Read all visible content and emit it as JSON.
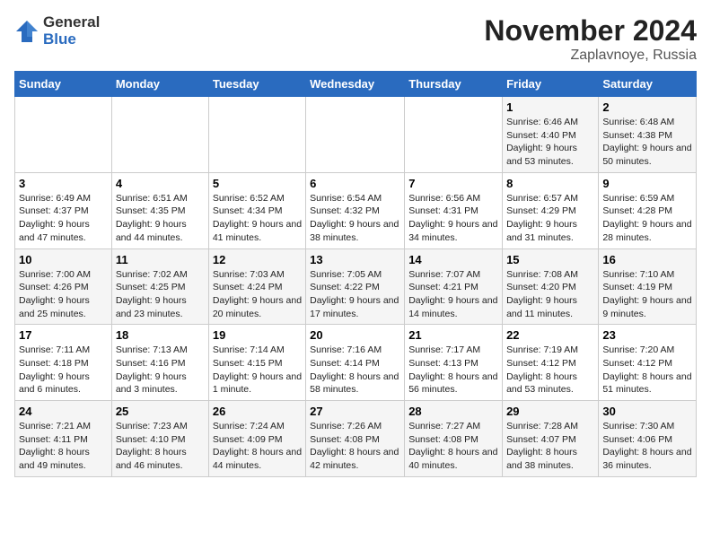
{
  "header": {
    "logo_general": "General",
    "logo_blue": "Blue",
    "month_title": "November 2024",
    "location": "Zaplavnoye, Russia"
  },
  "calendar": {
    "days_of_week": [
      "Sunday",
      "Monday",
      "Tuesday",
      "Wednesday",
      "Thursday",
      "Friday",
      "Saturday"
    ],
    "weeks": [
      [
        {
          "day": "",
          "info": ""
        },
        {
          "day": "",
          "info": ""
        },
        {
          "day": "",
          "info": ""
        },
        {
          "day": "",
          "info": ""
        },
        {
          "day": "",
          "info": ""
        },
        {
          "day": "1",
          "info": "Sunrise: 6:46 AM\nSunset: 4:40 PM\nDaylight: 9 hours and 53 minutes."
        },
        {
          "day": "2",
          "info": "Sunrise: 6:48 AM\nSunset: 4:38 PM\nDaylight: 9 hours and 50 minutes."
        }
      ],
      [
        {
          "day": "3",
          "info": "Sunrise: 6:49 AM\nSunset: 4:37 PM\nDaylight: 9 hours and 47 minutes."
        },
        {
          "day": "4",
          "info": "Sunrise: 6:51 AM\nSunset: 4:35 PM\nDaylight: 9 hours and 44 minutes."
        },
        {
          "day": "5",
          "info": "Sunrise: 6:52 AM\nSunset: 4:34 PM\nDaylight: 9 hours and 41 minutes."
        },
        {
          "day": "6",
          "info": "Sunrise: 6:54 AM\nSunset: 4:32 PM\nDaylight: 9 hours and 38 minutes."
        },
        {
          "day": "7",
          "info": "Sunrise: 6:56 AM\nSunset: 4:31 PM\nDaylight: 9 hours and 34 minutes."
        },
        {
          "day": "8",
          "info": "Sunrise: 6:57 AM\nSunset: 4:29 PM\nDaylight: 9 hours and 31 minutes."
        },
        {
          "day": "9",
          "info": "Sunrise: 6:59 AM\nSunset: 4:28 PM\nDaylight: 9 hours and 28 minutes."
        }
      ],
      [
        {
          "day": "10",
          "info": "Sunrise: 7:00 AM\nSunset: 4:26 PM\nDaylight: 9 hours and 25 minutes."
        },
        {
          "day": "11",
          "info": "Sunrise: 7:02 AM\nSunset: 4:25 PM\nDaylight: 9 hours and 23 minutes."
        },
        {
          "day": "12",
          "info": "Sunrise: 7:03 AM\nSunset: 4:24 PM\nDaylight: 9 hours and 20 minutes."
        },
        {
          "day": "13",
          "info": "Sunrise: 7:05 AM\nSunset: 4:22 PM\nDaylight: 9 hours and 17 minutes."
        },
        {
          "day": "14",
          "info": "Sunrise: 7:07 AM\nSunset: 4:21 PM\nDaylight: 9 hours and 14 minutes."
        },
        {
          "day": "15",
          "info": "Sunrise: 7:08 AM\nSunset: 4:20 PM\nDaylight: 9 hours and 11 minutes."
        },
        {
          "day": "16",
          "info": "Sunrise: 7:10 AM\nSunset: 4:19 PM\nDaylight: 9 hours and 9 minutes."
        }
      ],
      [
        {
          "day": "17",
          "info": "Sunrise: 7:11 AM\nSunset: 4:18 PM\nDaylight: 9 hours and 6 minutes."
        },
        {
          "day": "18",
          "info": "Sunrise: 7:13 AM\nSunset: 4:16 PM\nDaylight: 9 hours and 3 minutes."
        },
        {
          "day": "19",
          "info": "Sunrise: 7:14 AM\nSunset: 4:15 PM\nDaylight: 9 hours and 1 minute."
        },
        {
          "day": "20",
          "info": "Sunrise: 7:16 AM\nSunset: 4:14 PM\nDaylight: 8 hours and 58 minutes."
        },
        {
          "day": "21",
          "info": "Sunrise: 7:17 AM\nSunset: 4:13 PM\nDaylight: 8 hours and 56 minutes."
        },
        {
          "day": "22",
          "info": "Sunrise: 7:19 AM\nSunset: 4:12 PM\nDaylight: 8 hours and 53 minutes."
        },
        {
          "day": "23",
          "info": "Sunrise: 7:20 AM\nSunset: 4:12 PM\nDaylight: 8 hours and 51 minutes."
        }
      ],
      [
        {
          "day": "24",
          "info": "Sunrise: 7:21 AM\nSunset: 4:11 PM\nDaylight: 8 hours and 49 minutes."
        },
        {
          "day": "25",
          "info": "Sunrise: 7:23 AM\nSunset: 4:10 PM\nDaylight: 8 hours and 46 minutes."
        },
        {
          "day": "26",
          "info": "Sunrise: 7:24 AM\nSunset: 4:09 PM\nDaylight: 8 hours and 44 minutes."
        },
        {
          "day": "27",
          "info": "Sunrise: 7:26 AM\nSunset: 4:08 PM\nDaylight: 8 hours and 42 minutes."
        },
        {
          "day": "28",
          "info": "Sunrise: 7:27 AM\nSunset: 4:08 PM\nDaylight: 8 hours and 40 minutes."
        },
        {
          "day": "29",
          "info": "Sunrise: 7:28 AM\nSunset: 4:07 PM\nDaylight: 8 hours and 38 minutes."
        },
        {
          "day": "30",
          "info": "Sunrise: 7:30 AM\nSunset: 4:06 PM\nDaylight: 8 hours and 36 minutes."
        }
      ]
    ]
  }
}
